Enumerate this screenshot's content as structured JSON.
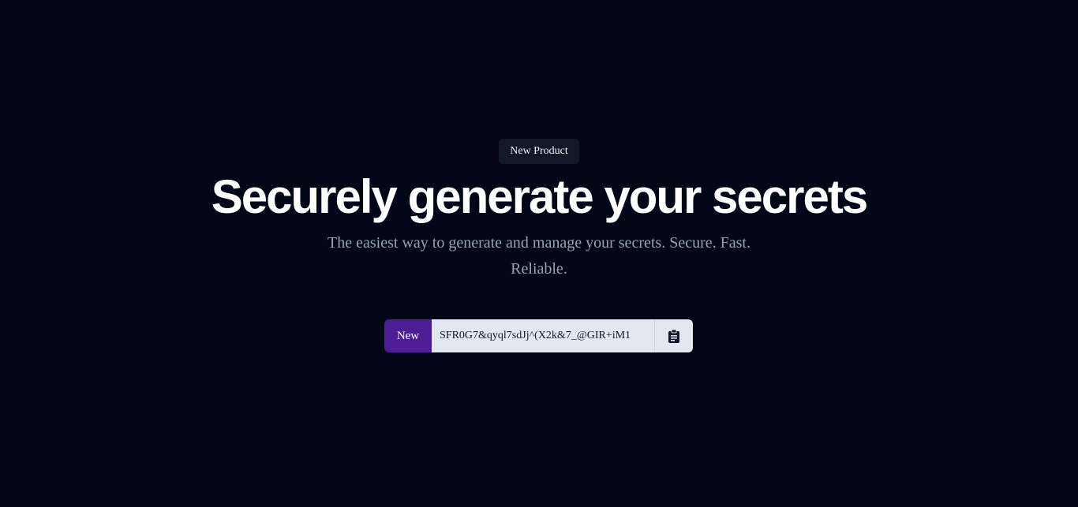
{
  "badge": {
    "label": "New Product"
  },
  "hero": {
    "title": "Securely generate your secrets",
    "subtitle": "The easiest way to generate and manage your secrets. Secure. Fast. Reliable."
  },
  "generator": {
    "new_label": "New",
    "secret_value": "SFR0G7&qyql7sdJj^(X2k&7_@GIR+iM1",
    "copy_icon": "clipboard-icon"
  },
  "colors": {
    "background": "#020617",
    "accent": "#4c1d95",
    "input_background": "#e2e8f0",
    "muted_text": "#94a3b8"
  }
}
